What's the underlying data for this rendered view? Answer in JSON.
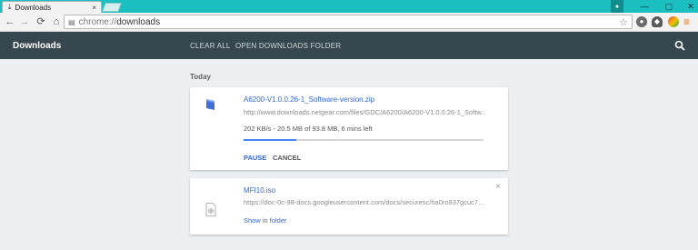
{
  "browser": {
    "tab_title": "Downloads",
    "tab_close": "×",
    "url_scheme": "chrome://",
    "url_path": "downloads",
    "window_controls": {
      "minimize": "—",
      "maximize": "▢",
      "close": "✕"
    },
    "nav": {
      "back": "←",
      "forward": "→",
      "reload": "⟳",
      "home": "⌂"
    },
    "icons": [
      "download-icon",
      "profile-icon",
      "page-icon",
      "star-icon",
      "extension-icons",
      "menu-icon"
    ]
  },
  "header": {
    "title": "Downloads",
    "clear_all": "CLEAR ALL",
    "open_folder": "OPEN DOWNLOADS FOLDER"
  },
  "section": {
    "date": "Today"
  },
  "downloads": [
    {
      "file_name": "A6200-V1.0.0.26-1_Software-version.zip",
      "url": "http://www.downloads.netgear.com/files/GDC/A6200/A6200-V1.0.0.26-1_Softw...",
      "status": "202 KB/s - 20.5 MB of 93.8 MB, 6 mins left",
      "progress": 0.22,
      "pause": "PAUSE",
      "cancel": "CANCEL"
    },
    {
      "file_name": "MFI10.iso",
      "url": "https://doc-0c-98-docs.googleusercontent.com/docs/securesc/ha0ro937gcuc7...",
      "show_in_folder": "Show in folder",
      "remove": "×"
    }
  ],
  "colors": {
    "titlebar": "#1cbfbf",
    "header_bg": "#37474f",
    "link": "#3367d6",
    "progress": "#4285f4",
    "page_bg": "#eceff1"
  }
}
